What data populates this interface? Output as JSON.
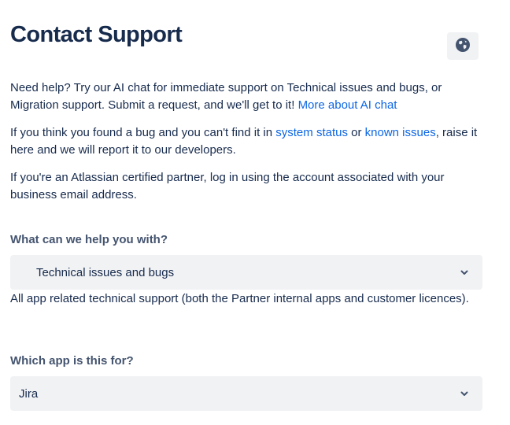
{
  "header": {
    "title": "Contact Support",
    "language_icon": "globe-icon"
  },
  "intro": {
    "p1_text": "Need help? Try our AI chat for immediate support on Technical issues and bugs, or Migration support. Submit a request, and we'll get to it!",
    "p1_link": "More about AI chat",
    "p2_before": "If you think you found a bug and you can't find it in",
    "p2_link1": "system status",
    "p2_mid": "or",
    "p2_link2": "known issues",
    "p2_after": ", raise it here and we will report it to our developers.",
    "p3_text": "If you're an Atlassian certified partner, log in using the account associated with your business email address."
  },
  "form": {
    "help_label": "What can we help you with?",
    "help_value": "Technical issues and bugs",
    "help_description": "All app related technical support (both the Partner internal apps and customer licences).",
    "app_label": "Which app is this for?",
    "app_value": "Jira"
  },
  "colors": {
    "link": "#0c66e4",
    "text": "#172b4d",
    "label": "#44546f",
    "field_bg": "#f1f2f4"
  }
}
